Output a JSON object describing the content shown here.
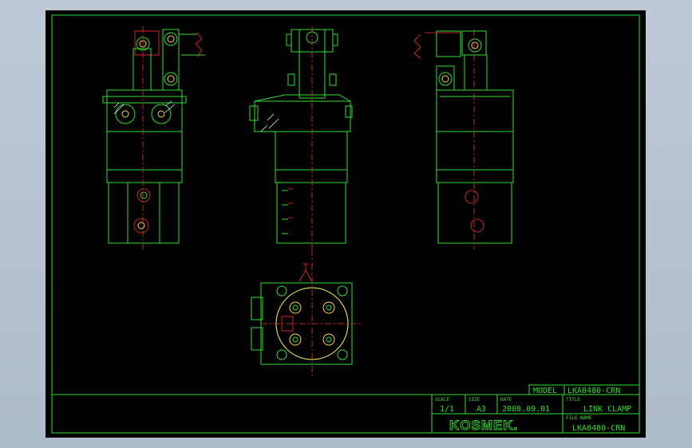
{
  "title_block": {
    "model_label": "MODEL",
    "model_value": "LKA0480-CRN",
    "scale_label": "SCALE",
    "scale_value": "1/1",
    "size_label": "SIZE",
    "size_value": "A3",
    "date_label": "DATE",
    "date_value": "2008.09.01",
    "title_label": "TITLE",
    "title_value": "LINK CLAMP",
    "filename_label": "FILE NAME",
    "filename_value": "LKA0480-CRN",
    "logo_text": "KOSMEK."
  },
  "colors": {
    "background": "#000000",
    "outline": "#2fe02f",
    "centerline": "#ff3030",
    "fastener": "#ffd84a",
    "hatch": "#ffffff"
  }
}
